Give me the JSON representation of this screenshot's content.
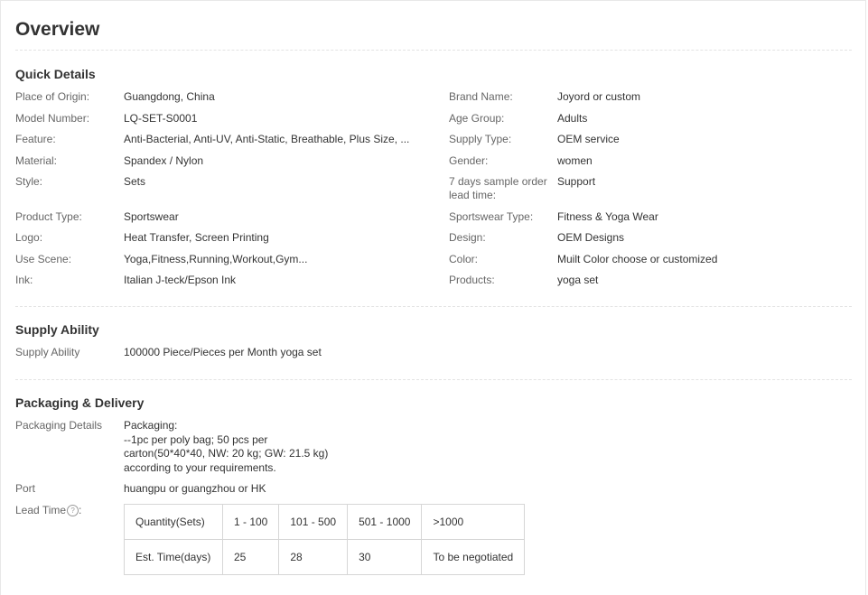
{
  "overview": {
    "title": "Overview"
  },
  "quick_details": {
    "title": "Quick Details",
    "left": [
      {
        "label": "Place of Origin:",
        "value": "Guangdong, China"
      },
      {
        "label": "Model Number:",
        "value": "LQ-SET-S0001"
      },
      {
        "label": "Feature:",
        "value": "Anti-Bacterial, Anti-UV, Anti-Static, Breathable, Plus Size, ..."
      },
      {
        "label": "Material:",
        "value": "Spandex / Nylon"
      },
      {
        "label": "Style:",
        "value": "Sets"
      },
      {
        "label": "Product Type:",
        "value": "Sportswear"
      },
      {
        "label": "Logo:",
        "value": "Heat Transfer, Screen Printing"
      },
      {
        "label": "Use Scene:",
        "value": "Yoga,Fitness,Running,Workout,Gym..."
      },
      {
        "label": "Ink:",
        "value": "Italian J-teck/Epson Ink"
      }
    ],
    "right": [
      {
        "label": "Brand Name:",
        "value": "Joyord or custom"
      },
      {
        "label": "Age Group:",
        "value": "Adults"
      },
      {
        "label": "Supply Type:",
        "value": "OEM service"
      },
      {
        "label": "Gender:",
        "value": "women"
      },
      {
        "label": "7 days sample order lead time:",
        "value": "Support"
      },
      {
        "label": "Sportswear Type:",
        "value": "Fitness & Yoga Wear"
      },
      {
        "label": "Design:",
        "value": "OEM Designs"
      },
      {
        "label": "Color:",
        "value": "Muilt Color choose or customized"
      },
      {
        "label": "Products:",
        "value": "yoga set"
      }
    ]
  },
  "supply_ability": {
    "title": "Supply Ability",
    "label": "Supply Ability",
    "value": "100000 Piece/Pieces per Month yoga set"
  },
  "packaging_delivery": {
    "title": "Packaging & Delivery",
    "details_label": "Packaging Details",
    "details_lines": [
      "Packaging:",
      "--1pc per poly bag; 50 pcs per",
      "carton(50*40*40, NW: 20 kg; GW: 21.5 kg)",
      "according to your requirements."
    ],
    "port_label": "Port",
    "port_value": "huangpu or guangzhou or HK",
    "lead_time_label": "Lead Time",
    "lead_time_help_icon": "question-mark-circle-icon",
    "lead_time_help_glyph": "?",
    "lead_table": {
      "row1": [
        "Quantity(Sets)",
        "1 - 100",
        "101 - 500",
        "501 - 1000",
        ">1000"
      ],
      "row2": [
        "Est. Time(days)",
        "25",
        "28",
        "30",
        "To be negotiated"
      ]
    }
  }
}
